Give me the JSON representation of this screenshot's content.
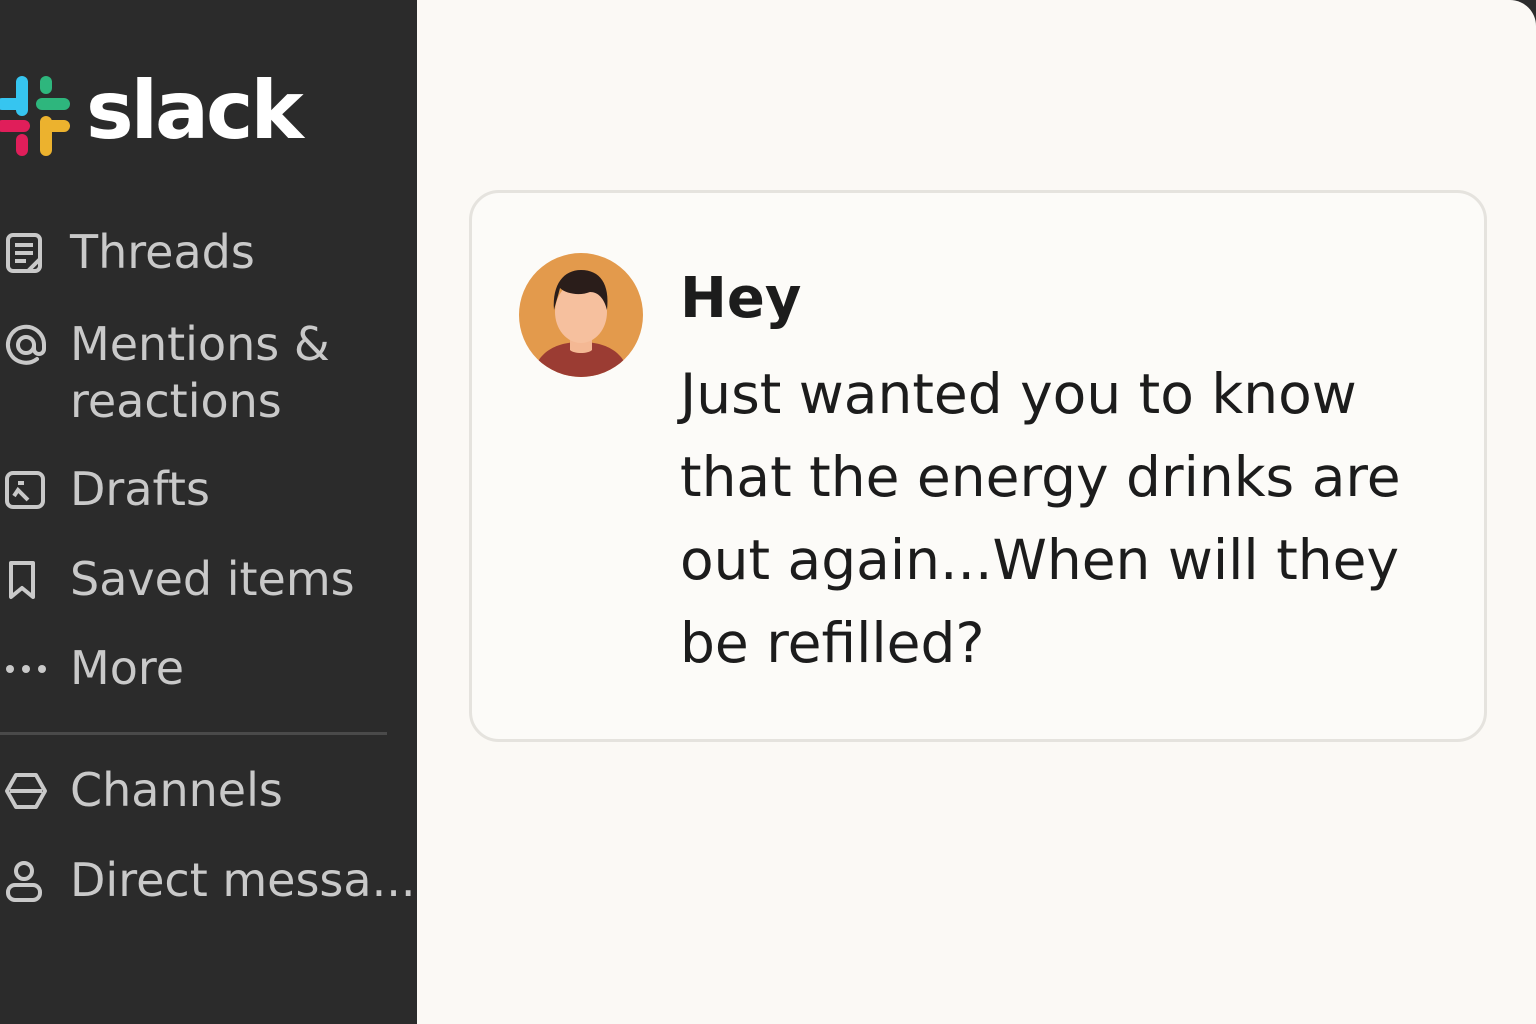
{
  "app": {
    "logo_text": "slack"
  },
  "sidebar": {
    "items": [
      {
        "label": "Threads",
        "icon": "threads-icon"
      },
      {
        "label": "Mentions & reactions",
        "icon": "at-sign-icon"
      },
      {
        "label": "Drafts",
        "icon": "drafts-icon"
      },
      {
        "label": "Saved items",
        "icon": "bookmark-icon"
      },
      {
        "label": "More",
        "icon": "more-icon"
      }
    ],
    "sections": [
      {
        "label": "Channels",
        "icon": "channels-icon"
      },
      {
        "label": "Direct messa...",
        "icon": "person-icon"
      }
    ]
  },
  "message": {
    "sender": "Hey",
    "text": "Just wanted you to know that the energy drinks are out again...When will they be refilled?"
  },
  "colors": {
    "sidebar_bg": "#2b2b2b",
    "main_bg": "#fbf9f5",
    "avatar_bg": "#e39a4c",
    "avatar_shirt": "#a13f35",
    "logo_blue": "#36c5f0",
    "logo_green": "#2eb67d",
    "logo_yellow": "#ecb22e",
    "logo_red": "#e01e5a"
  }
}
